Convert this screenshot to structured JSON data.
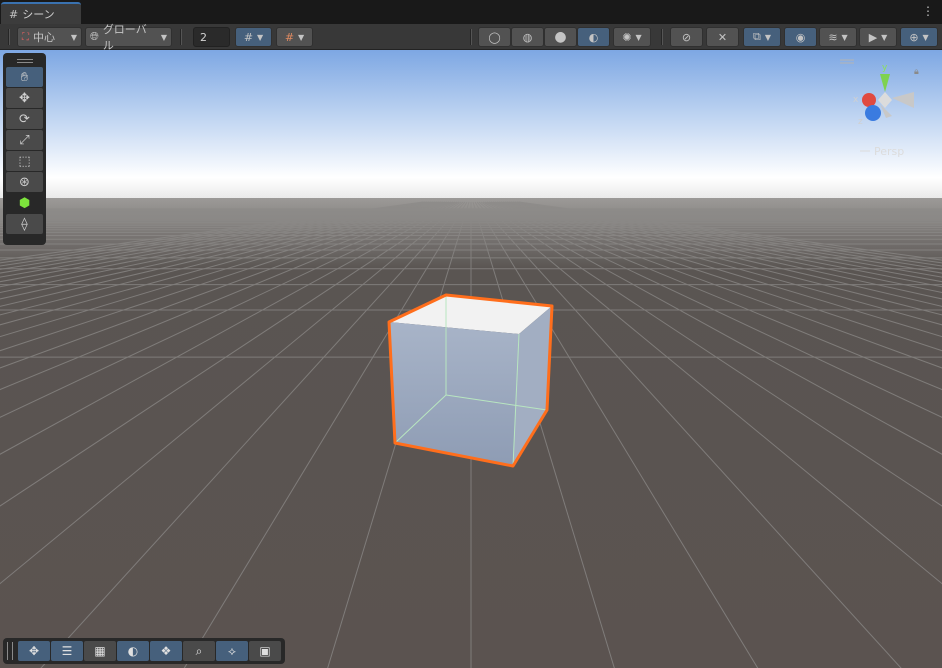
{
  "tab": {
    "icon": "grid-icon",
    "label": "シーン",
    "menu": "⋮"
  },
  "toolbar": {
    "pivot_label": "中心",
    "space_label": "グローバル",
    "grid_snap_value": "2",
    "shading_modes": [
      "wireframe",
      "shaded-wireframe",
      "shaded",
      "unlit"
    ],
    "active_shading": "unlit"
  },
  "tools": [
    "hand-tool",
    "move-tool",
    "rotate-tool",
    "scale-tool",
    "rect-tool",
    "transform-tool",
    "custom-tool",
    "probuilder-tool"
  ],
  "active_tool": "hand-tool",
  "bottom_tools": [
    "move-tool",
    "fov-tool",
    "grid-tool",
    "shading-tool",
    "layers-tool",
    "search-tool",
    "pivot-tool",
    "camera-tool"
  ],
  "gizmo": {
    "x": "x",
    "y": "y",
    "z": "z",
    "projection": "Persp"
  },
  "colors": {
    "sky_top": "#7da7e3",
    "sky_horizon": "#ffffff",
    "ground": "#5b5350",
    "grid_line": "#8c8a88",
    "selection": "#ff6e1c",
    "accent": "#46607c"
  }
}
